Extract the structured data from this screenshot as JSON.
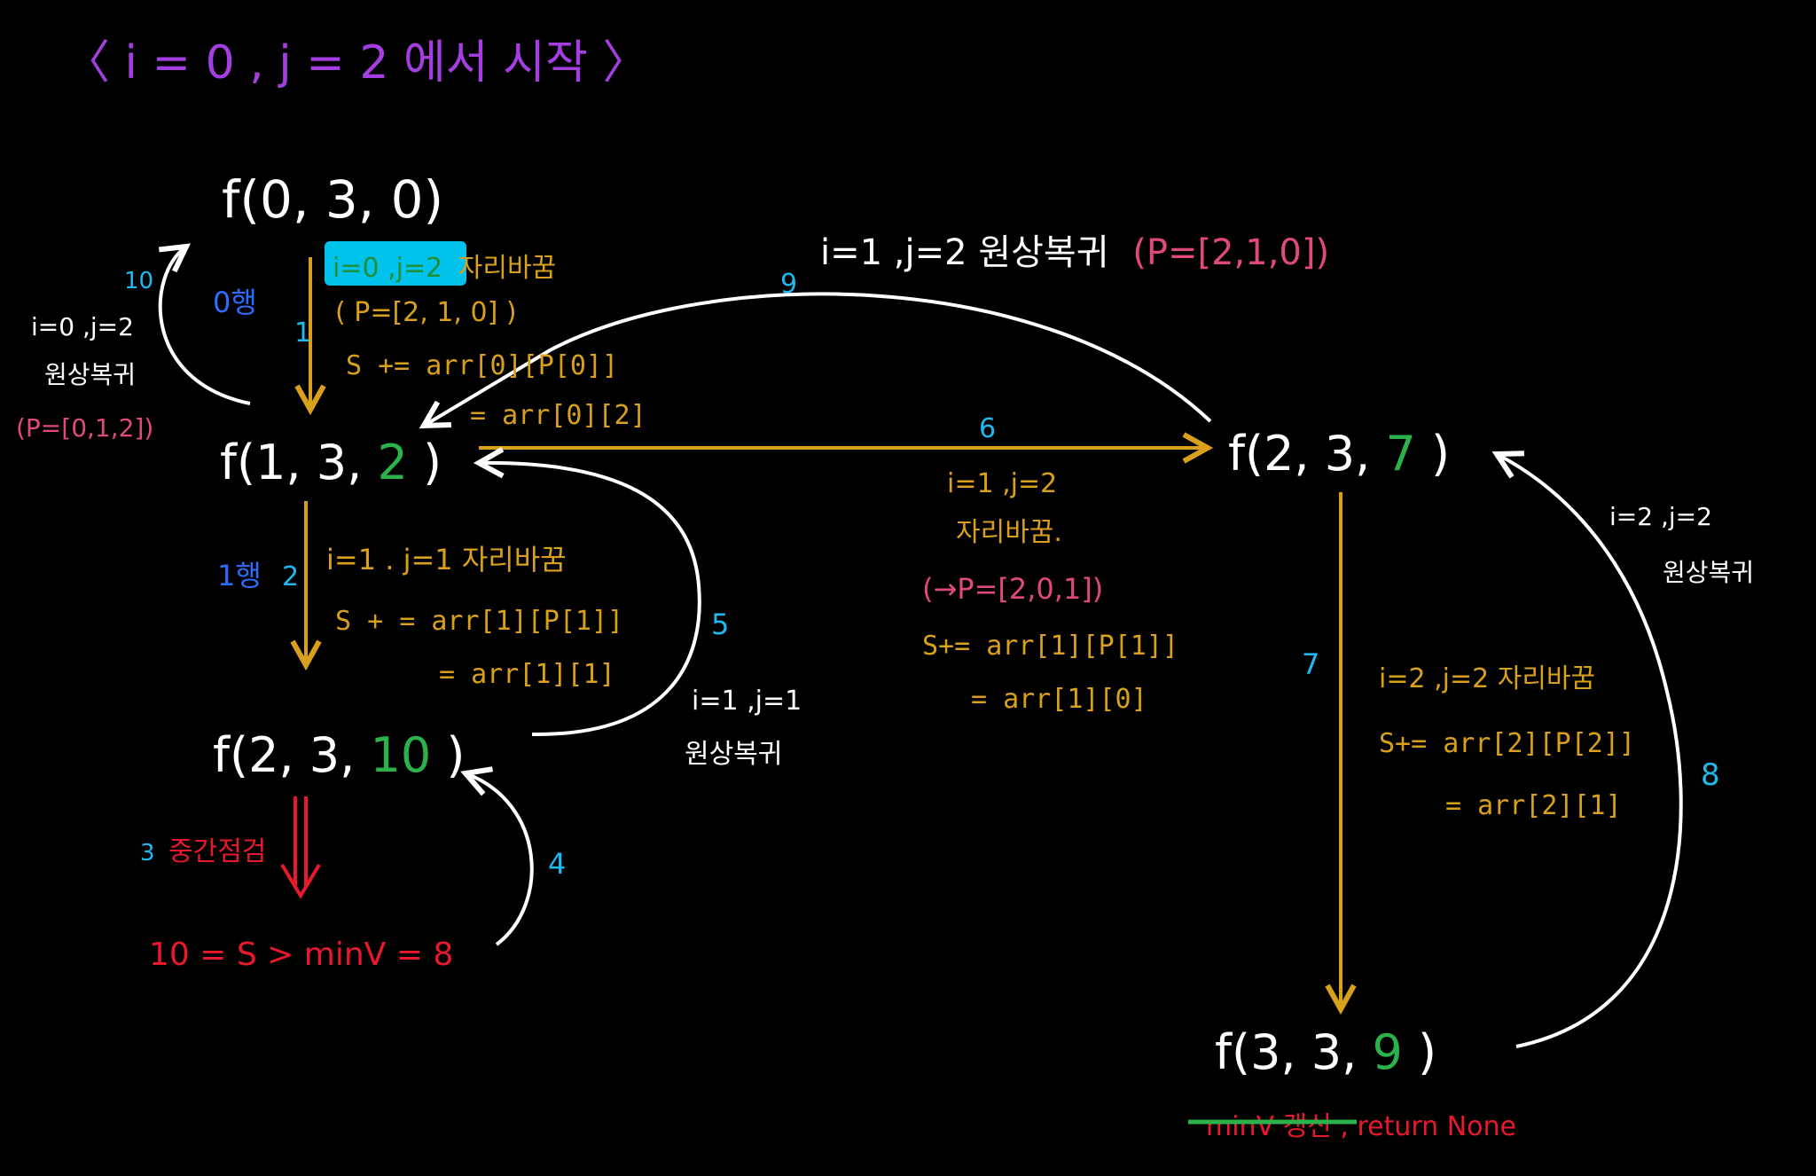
{
  "title": "〈 i = 0 , j = 2 에서 시작 〉",
  "colors": {
    "white": "#ffffff",
    "gold": "#d9a01c",
    "cyan": "#1fb8f0",
    "blue": "#2e6cff",
    "green": "#2bb24a",
    "red": "#e8192c",
    "pink": "#e0497f",
    "purple": "#a43ee0",
    "highlight": "#00c2ea",
    "highlight_text": "#1f8f3a"
  },
  "nodes": {
    "n1": {
      "prefix": "f(0, 3, 0)",
      "value": "",
      "suffix": ""
    },
    "n2": {
      "prefix": "f(1, 3,",
      "value": "2",
      "suffix": ")"
    },
    "n3": {
      "prefix": "f(2, 3,",
      "value": "10",
      "suffix": ")"
    },
    "n4": {
      "prefix": "f(2, 3,",
      "value": "7",
      "suffix": ")"
    },
    "n5": {
      "prefix": "f(3, 3,",
      "value": "9",
      "suffix": ")"
    }
  },
  "steps": {
    "s1": "1",
    "s2": "2",
    "s3": "3",
    "s4": "4",
    "s5": "5",
    "s6": "6",
    "s7": "7",
    "s8": "8",
    "s9": "9",
    "s10": "10"
  },
  "row_labels": {
    "row0": "0행",
    "row1": "1행"
  },
  "notes": {
    "a_swap_hl": "i=0 ,j=2",
    "a_swap_rest": "자리바꿈",
    "a_perm": "( P=[2, 1, 0] )",
    "a_sum1": "S  +=  arr[0][P[0]]",
    "a_sum2": "= arr[0][2]",
    "b_swap": "i=1 . j=1   자리바꿈",
    "b_sum1": "S + =  arr[1][P[1]]",
    "b_sum2": "= arr[1][1]",
    "c_swap1": "i=1 ,j=2",
    "c_swap2": "자리바꿈.",
    "c_perm": "(→P=[2,0,1])",
    "c_sum1": "S+= arr[1][P[1]]",
    "c_sum2": "= arr[1][0]",
    "d_swap": "i=2 ,j=2  자리바꿈",
    "d_sum1": "S+= arr[2][P[2]]",
    "d_sum2": "= arr[2][1]",
    "restore_top_text": "i=1 ,j=2  원상복귀",
    "restore_top_perm": "(P=[2,1,0])",
    "restore_left1": "i=0 ,j=2",
    "restore_left2": "원상복귀",
    "restore_left_perm": "(P=[0,1,2])",
    "restore_mid1": "i=1 ,j=1",
    "restore_mid2": "원상복귀",
    "restore_right1": "i=2 ,j=2",
    "restore_right2": "원상복귀",
    "prune_label": "중간점검",
    "prune_cond": "10 = S  >  minV = 8",
    "end_struck": "minV 갱신",
    "end_rest": ", return None"
  }
}
